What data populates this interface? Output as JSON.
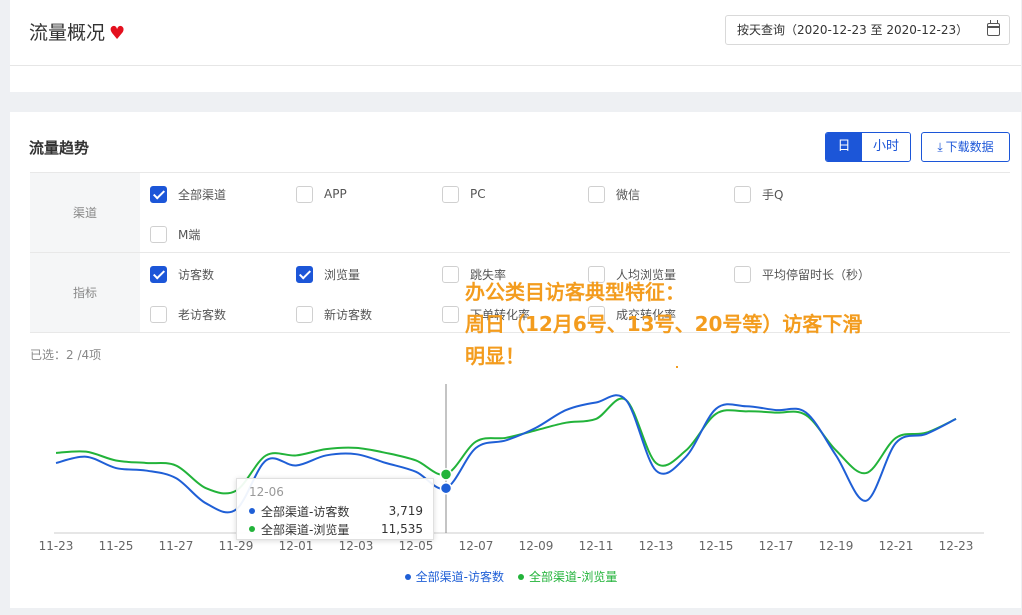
{
  "header": {
    "title": "流量概况",
    "date_range": "按天查询（2020-12-23 至 2020-12-23）"
  },
  "trend": {
    "title": "流量趋势",
    "granularity": {
      "day": "日",
      "hour": "小时",
      "selected": "day"
    },
    "download_label": "下载数据",
    "channel_label": "渠道",
    "metric_label": "指标",
    "channels": [
      {
        "label": "全部渠道",
        "checked": true
      },
      {
        "label": "APP",
        "checked": false
      },
      {
        "label": "PC",
        "checked": false
      },
      {
        "label": "微信",
        "checked": false
      },
      {
        "label": "手Q",
        "checked": false
      },
      {
        "label": "M端",
        "checked": false
      }
    ],
    "metrics": [
      {
        "label": "访客数",
        "checked": true
      },
      {
        "label": "浏览量",
        "checked": true
      },
      {
        "label": "跳失率",
        "checked": false
      },
      {
        "label": "人均浏览量",
        "checked": false
      },
      {
        "label": "平均停留时长（秒）",
        "checked": false
      },
      {
        "label": "老访客数",
        "checked": false
      },
      {
        "label": "新访客数",
        "checked": false
      },
      {
        "label": "下单转化率",
        "checked": false
      },
      {
        "label": "成交转化率",
        "checked": false
      }
    ],
    "selected_count": "已选：2 /4项"
  },
  "tooltip": {
    "date": "12-06",
    "rows": [
      {
        "name": "全部渠道-访客数",
        "value": "3,719"
      },
      {
        "name": "全部渠道-浏览量",
        "value": "11,535"
      }
    ]
  },
  "overlay_note": {
    "line1": "办公类目访客典型特征：",
    "line2": "周日（12月6号、13号、20号等）访客下滑",
    "line3": "明显！"
  },
  "colors": {
    "accent": "#1c56d8",
    "visitors": "#1f5fd6",
    "pageviews": "#22b33a",
    "note": "#f39c1e"
  },
  "chart_data": {
    "type": "line",
    "x": [
      "11-23",
      "11-24",
      "11-25",
      "11-26",
      "11-27",
      "11-28",
      "11-29",
      "11-30",
      "12-01",
      "12-02",
      "12-03",
      "12-04",
      "12-05",
      "12-06",
      "12-07",
      "12-08",
      "12-09",
      "12-10",
      "12-11",
      "12-12",
      "12-13",
      "12-14",
      "12-15",
      "12-16",
      "12-17",
      "12-18",
      "12-19",
      "12-20",
      "12-21",
      "12-22",
      "12-23"
    ],
    "x_tick_labels": [
      "11-23",
      "11-25",
      "11-27",
      "11-29",
      "12-01",
      "12-03",
      "12-05",
      "12-07",
      "12-09",
      "12-11",
      "12-13",
      "12-15",
      "12-17",
      "12-19",
      "12-21",
      "12-23"
    ],
    "series": [
      {
        "name": "全部渠道-访客数",
        "values": [
          0.5,
          0.55,
          0.46,
          0.44,
          0.38,
          0.18,
          0.13,
          0.52,
          0.48,
          0.56,
          0.57,
          0.5,
          0.43,
          0.3,
          0.62,
          0.68,
          0.78,
          0.92,
          0.98,
          1.0,
          0.44,
          0.55,
          0.93,
          0.95,
          0.92,
          0.9,
          0.56,
          0.2,
          0.66,
          0.73,
          0.85
        ]
      },
      {
        "name": "全部渠道-浏览量",
        "values": [
          0.58,
          0.59,
          0.52,
          0.5,
          0.48,
          0.3,
          0.28,
          0.56,
          0.56,
          0.61,
          0.62,
          0.58,
          0.52,
          0.41,
          0.67,
          0.7,
          0.76,
          0.82,
          0.85,
          1.0,
          0.5,
          0.6,
          0.89,
          0.91,
          0.9,
          0.88,
          0.6,
          0.42,
          0.7,
          0.74,
          0.85
        ]
      }
    ],
    "grid": false,
    "legend": "bottom"
  }
}
